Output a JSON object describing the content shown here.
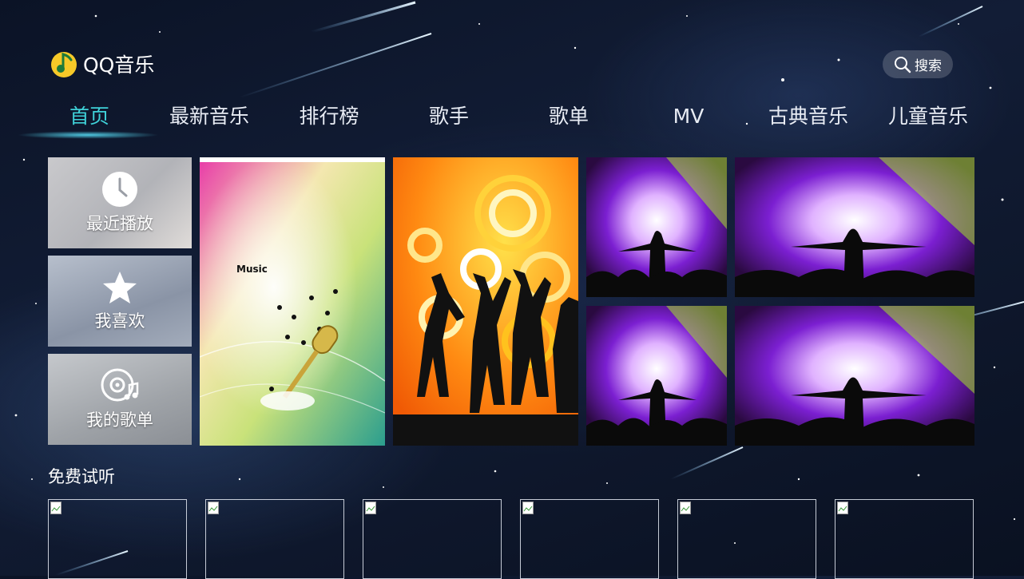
{
  "app": {
    "logo_text": "QQ音乐"
  },
  "search": {
    "label": "搜索"
  },
  "nav": {
    "items": [
      {
        "label": "首页",
        "active": true
      },
      {
        "label": "最新音乐"
      },
      {
        "label": "排行榜"
      },
      {
        "label": "歌手"
      },
      {
        "label": "歌单"
      },
      {
        "label": "MV"
      },
      {
        "label": "古典音乐"
      },
      {
        "label": "儿童音乐"
      }
    ]
  },
  "quick_access": [
    {
      "label": "最近播放",
      "icon": "clock-icon"
    },
    {
      "label": "我喜欢",
      "icon": "star-icon"
    },
    {
      "label": "我的歌单",
      "icon": "disc-music-icon"
    }
  ],
  "featured": {
    "poster1_text": "Music"
  },
  "free_listen": {
    "title": "免费试听"
  },
  "colors": {
    "accent": "#3fd1d8",
    "background": "#0e1830",
    "search_bg": "rgba(255,255,255,0.18)"
  }
}
